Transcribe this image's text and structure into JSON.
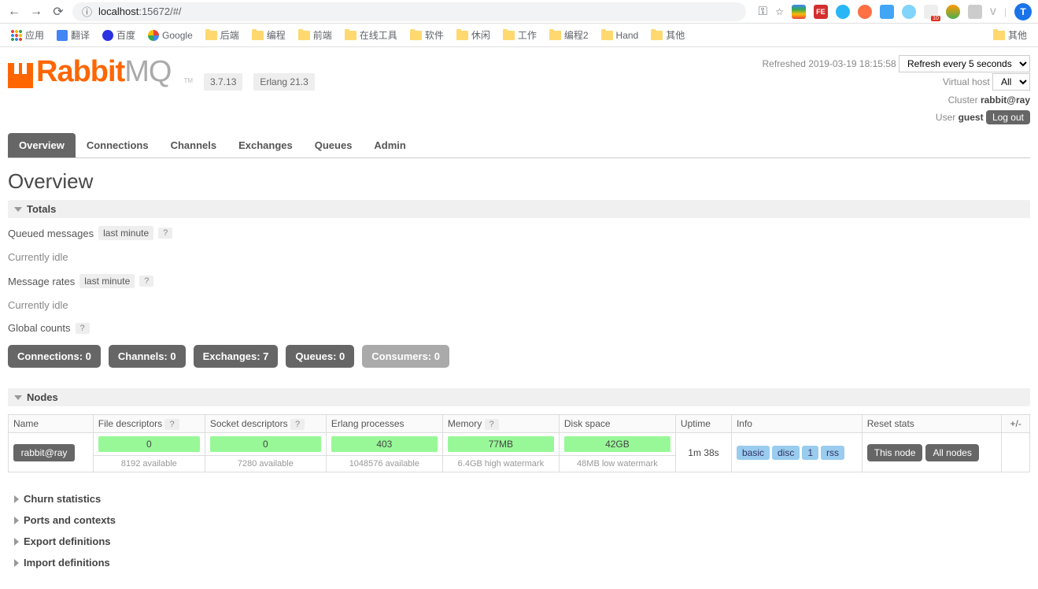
{
  "browser": {
    "url_prefix": "localhost",
    "url_suffix": ":15672/#/",
    "avatar_letter": "T",
    "bookmarks_label_apps": "应用",
    "bookmarks": [
      "翻译",
      "百度",
      "Google",
      "后端",
      "编程",
      "前端",
      "在线工具",
      "软件",
      "休闲",
      "工作",
      "编程2",
      "Hand",
      "其他"
    ],
    "bookmarks_overflow": "其他"
  },
  "header": {
    "brand_rabbit": "Rabbit",
    "brand_mq": "MQ",
    "tm": "TM",
    "version": "3.7.13",
    "erlang": "Erlang 21.3",
    "refreshed_label": "Refreshed 2019-03-19 18:15:58",
    "refresh_option": "Refresh every 5 seconds",
    "vhost_label": "Virtual host",
    "vhost_value": "All",
    "cluster_label": "Cluster",
    "cluster_value": "rabbit@ray",
    "user_label": "User",
    "user_value": "guest",
    "logout": "Log out"
  },
  "tabs": [
    "Overview",
    "Connections",
    "Channels",
    "Exchanges",
    "Queues",
    "Admin"
  ],
  "page_title": "Overview",
  "totals": {
    "section": "Totals",
    "queued_label": "Queued messages",
    "queued_range": "last minute",
    "idle1": "Currently idle",
    "rates_label": "Message rates",
    "rates_range": "last minute",
    "idle2": "Currently idle",
    "global_label": "Global counts",
    "help": "?"
  },
  "counts": {
    "connections_label": "Connections: 0",
    "channels_label": "Channels: 0",
    "exchanges_label": "Exchanges: 7",
    "queues_label": "Queues: 0",
    "consumers_label": "Consumers: 0"
  },
  "nodes": {
    "section": "Nodes",
    "cols": {
      "name": "Name",
      "fd": "File descriptors",
      "sd": "Socket descriptors",
      "ep": "Erlang processes",
      "mem": "Memory",
      "disk": "Disk space",
      "uptime": "Uptime",
      "info": "Info",
      "reset": "Reset stats",
      "pm": "+/-"
    },
    "row": {
      "name": "rabbit@ray",
      "fd_val": "0",
      "fd_avail": "8192 available",
      "sd_val": "0",
      "sd_avail": "7280 available",
      "ep_val": "403",
      "ep_avail": "1048576 available",
      "mem_val": "77MB",
      "mem_avail": "6.4GB high watermark",
      "disk_val": "42GB",
      "disk_avail": "48MB low watermark",
      "uptime": "1m 38s",
      "info": [
        "basic",
        "disc",
        "1",
        "rss"
      ],
      "reset_this": "This node",
      "reset_all": "All nodes"
    }
  },
  "collapsed": {
    "churn": "Churn statistics",
    "ports": "Ports and contexts",
    "export": "Export definitions",
    "import": "Import definitions"
  }
}
